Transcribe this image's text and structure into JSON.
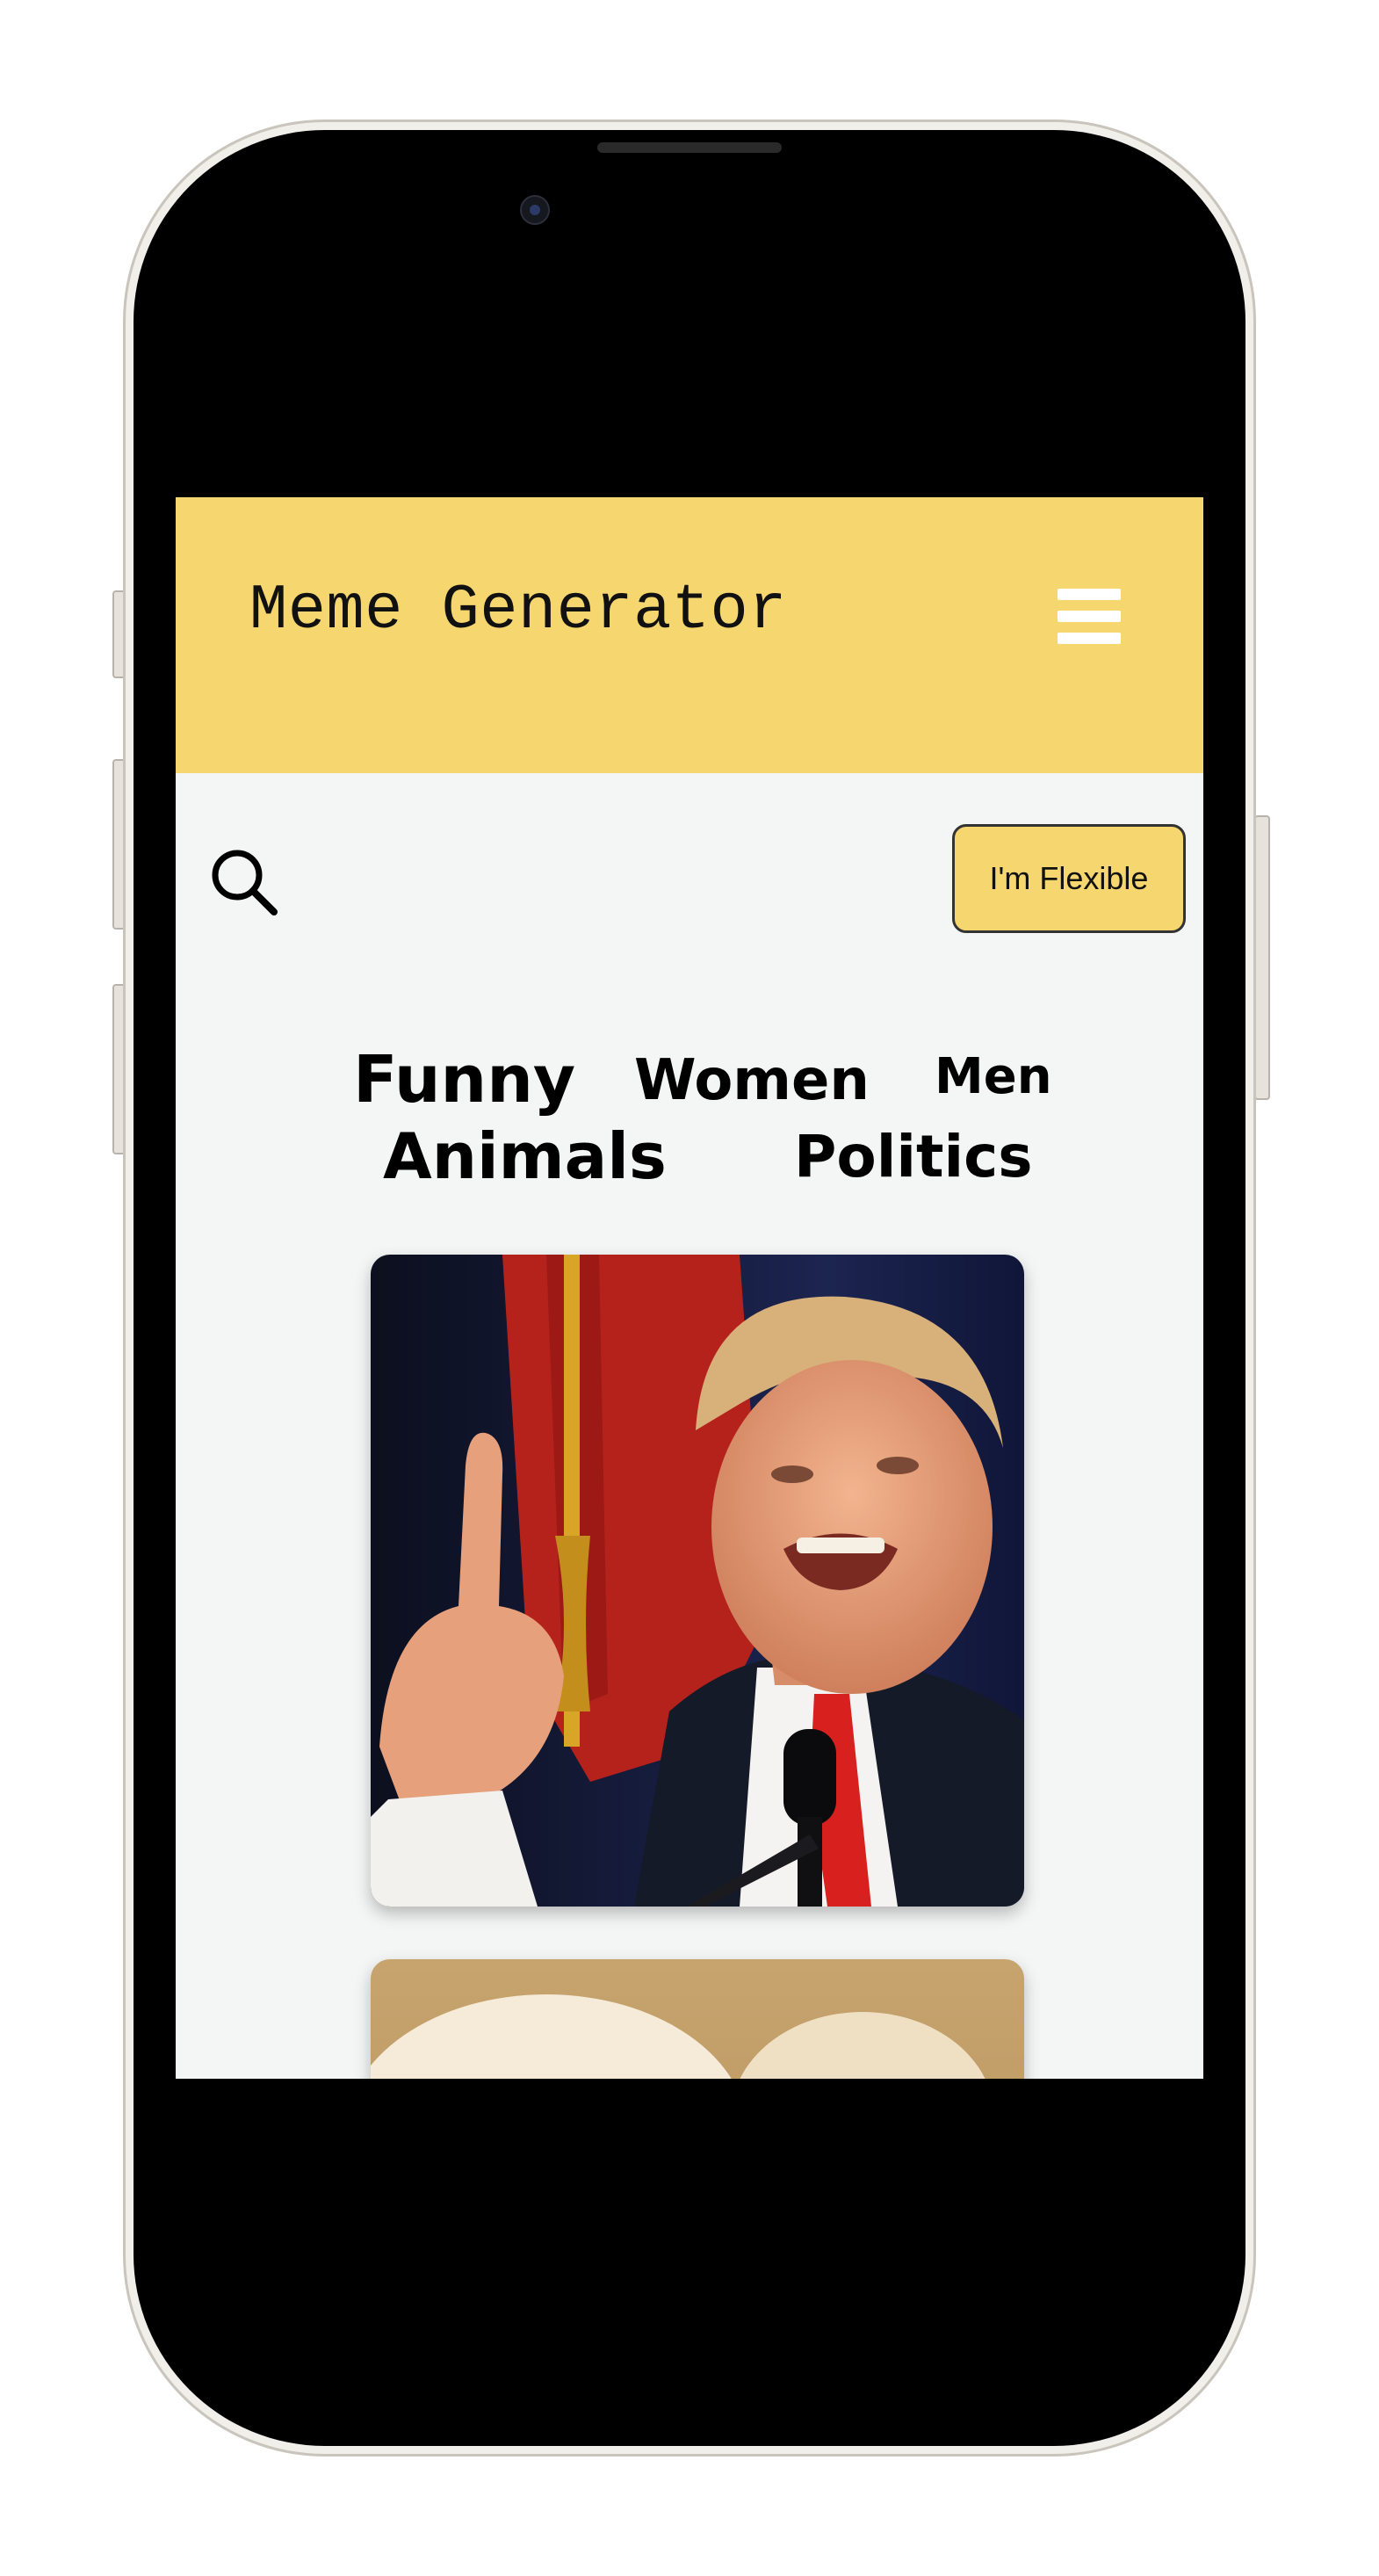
{
  "app": {
    "title": "Meme Generator"
  },
  "toolbar": {
    "flexible_label": "I'm Flexible"
  },
  "categories": [
    "Funny",
    "Women",
    "Men",
    "Animals",
    "Politics"
  ],
  "icons": {
    "menu": "hamburger-menu-icon",
    "search": "search-icon"
  },
  "colors": {
    "header": "#f6d66e",
    "background": "#f4f6f6",
    "button": "#f6d66e"
  }
}
